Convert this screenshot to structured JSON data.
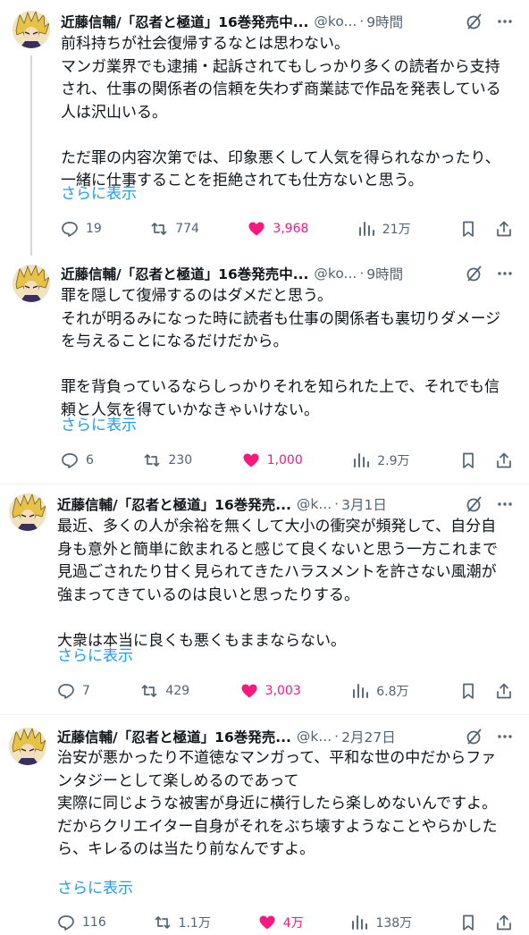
{
  "colors": {
    "accent": "#1d9bf0",
    "like": "#f91880",
    "muted": "#536471",
    "text": "#0f1419"
  },
  "tweets": [
    {
      "name": "近藤信輔/「忍者と極道」16巻発売中...",
      "handle": "@ko...",
      "sep": "·",
      "time": "9時間",
      "text": "前科持ちが社会復帰するなとは思わない。\nマンガ業界でも逮捕・起訴されてもしっかり多くの読者から支持され、仕事の関係者の信頼を失わず商業誌で作品を発表している人は沢山いる。\n\nただ罪の内容次第では、印象悪くして人気を得られなかったり、一緒に仕事することを拒絶されても仕方ないと思う。",
      "show_more": "さらに表示",
      "replies": "19",
      "reposts": "774",
      "likes": "3,968",
      "views": "21万"
    },
    {
      "name": "近藤信輔/「忍者と極道」16巻発売中...",
      "handle": "@ko...",
      "sep": "·",
      "time": "9時間",
      "text": "罪を隠して復帰するのはダメだと思う。\nそれが明るみになった時に読者も仕事の関係者も裏切りダメージを与えることになるだけだから。\n\n罪を背負っているならしっかりそれを知られた上で、それでも信頼と人気を得ていかなきゃいけない。",
      "show_more": "さらに表示",
      "replies": "6",
      "reposts": "230",
      "likes": "1,000",
      "views": "2.9万"
    },
    {
      "name": "近藤信輔/「忍者と極道」16巻発売...",
      "handle": "@k...",
      "sep": "·",
      "time": "3月1日",
      "text": "最近、多くの人が余裕を無くして大小の衝突が頻発して、自分自身も意外と簡単に飲まれると感じて良くないと思う一方これまで見過ごされたり甘く見られてきたハラスメントを許さない風潮が強まってきているのは良いと思ったりする。\n\n大衆は本当に良くも悪くもままならない。",
      "show_more": "さらに表示",
      "replies": "7",
      "reposts": "429",
      "likes": "3,003",
      "views": "6.8万"
    },
    {
      "name": "近藤信輔/「忍者と極道」16巻発売...",
      "handle": "@k...",
      "sep": "·",
      "time": "2月27日",
      "text": "治安が悪かったり不道徳なマンガって、平和な世の中だからファンタジーとして楽しめるのであって\n実際に同じような被害が身近に横行したら楽しめないんですよ。\nだからクリエイター自身がそれをぶち壊すようなことやらかしたら、キレるのは当たり前なんですよ。",
      "show_more": "さらに表示",
      "replies": "116",
      "reposts": "1.1万",
      "likes": "4万",
      "views": "138万"
    }
  ]
}
